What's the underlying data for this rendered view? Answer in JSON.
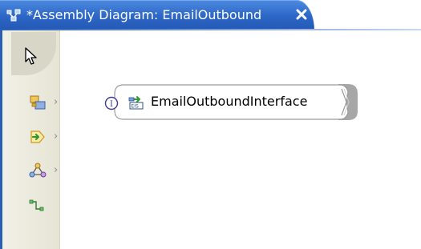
{
  "editor": {
    "tab_title": "*Assembly Diagram: EmailOutbound",
    "tab_icon": "assembly-diagram-icon",
    "close_icon": "close-icon"
  },
  "palette": {
    "selection_tool": "select-arrow-icon",
    "items": [
      {
        "icon": "component-icon",
        "has_submenu": true
      },
      {
        "icon": "import-export-icon",
        "has_submenu": true
      },
      {
        "icon": "component-group-icon",
        "has_submenu": true
      },
      {
        "icon": "wire-icon",
        "has_submenu": false
      }
    ],
    "chevron": "›"
  },
  "diagram": {
    "node": {
      "label": "EmailOutboundInterface",
      "badge": "I",
      "badge_icon": "interface-icon",
      "type_icon": "eis-import-icon"
    }
  },
  "colors": {
    "tab_blue": "#2c66c6",
    "palette_bg": "#ece9d8",
    "node_stroke": "#9a9a9a",
    "badge_purple": "#3b3a9e"
  }
}
